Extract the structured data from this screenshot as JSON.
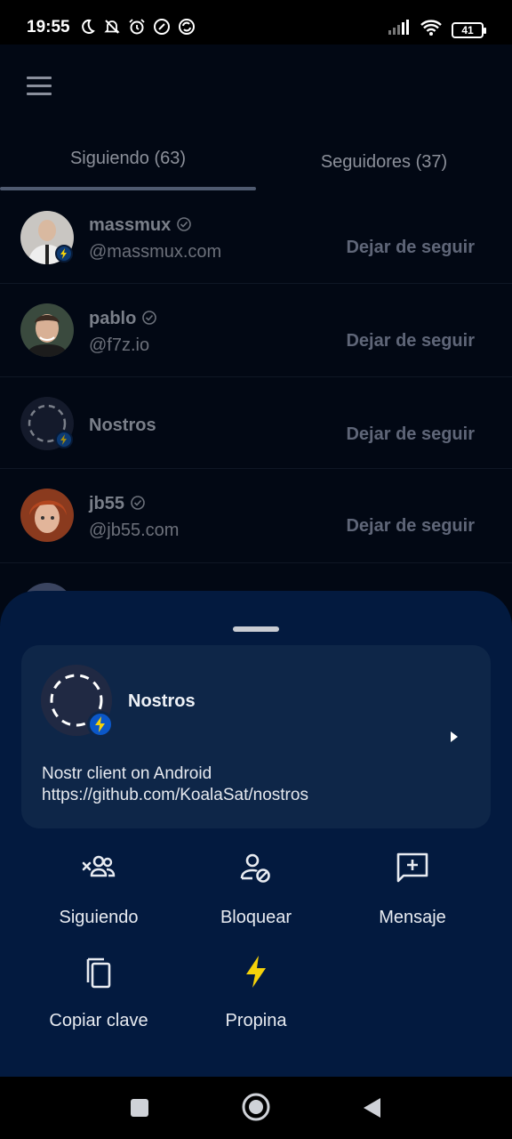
{
  "status_bar": {
    "time": "19:55",
    "battery": "41"
  },
  "tabs": [
    {
      "label": "Siguiendo (63)"
    },
    {
      "label": "Seguidores (37)"
    }
  ],
  "following": [
    {
      "name": "massmux",
      "handle": "@massmux.com",
      "verified": true,
      "action": "Dejar de seguir"
    },
    {
      "name": "pablo",
      "handle": "@f7z.io",
      "verified": true,
      "action": "Dejar de seguir"
    },
    {
      "name": "Nostros",
      "handle": "",
      "verified": false,
      "action": "Dejar de seguir"
    },
    {
      "name": "jb55",
      "handle": "@jb55.com",
      "verified": true,
      "action": "Dejar de seguir"
    }
  ],
  "sheet": {
    "profile": {
      "name": "Nostros",
      "about_line1": "Nostr client on Android",
      "about_line2": "https://github.com/KoalaSat/nostros"
    },
    "actions": [
      {
        "label": "Siguiendo",
        "icon": "unfollow-people-icon"
      },
      {
        "label": "Bloquear",
        "icon": "block-user-icon"
      },
      {
        "label": "Mensaje",
        "icon": "message-add-icon"
      },
      {
        "label": "Copiar clave",
        "icon": "copy-icon"
      },
      {
        "label": "Propina",
        "icon": "lightning-icon"
      }
    ]
  },
  "colors": {
    "background": "#020814",
    "sheet": "#031a3f",
    "card": "#0e2648",
    "accent_lightning": "#f5d20a"
  }
}
